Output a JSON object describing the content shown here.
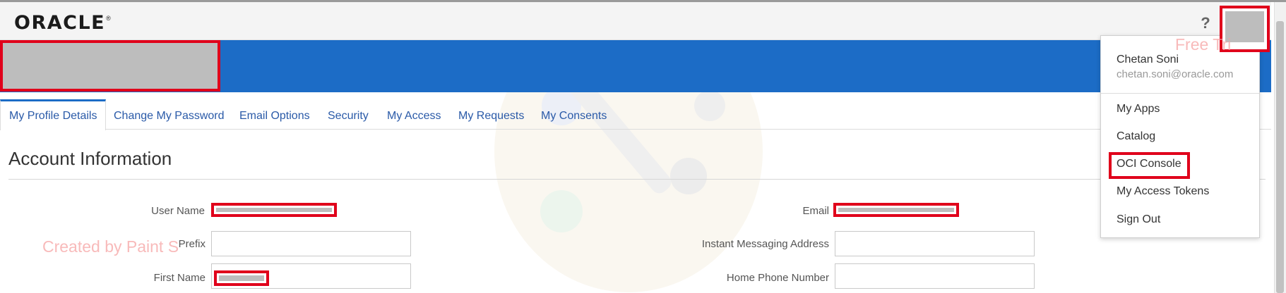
{
  "header": {
    "logo_text": "ORACLE",
    "logo_mark": "®",
    "help_label": "?",
    "help_icon": "question-icon",
    "avatar_icon": "user-avatar-icon"
  },
  "tabs": [
    {
      "label": "My Profile Details",
      "active": true
    },
    {
      "label": "Change My Password",
      "active": false
    },
    {
      "label": "Email Options",
      "active": false
    },
    {
      "label": "Security",
      "active": false
    },
    {
      "label": "My Access",
      "active": false
    },
    {
      "label": "My Requests",
      "active": false
    },
    {
      "label": "My Consents",
      "active": false
    }
  ],
  "section": {
    "title": "Account Information"
  },
  "form": {
    "user_name_label": "User Name",
    "email_label": "Email",
    "prefix_label": "Prefix",
    "prefix_value": "",
    "im_label": "Instant Messaging Address",
    "im_value": "",
    "first_name_label": "First Name",
    "home_phone_label": "Home Phone Number",
    "home_phone_value": ""
  },
  "dropdown": {
    "user_name": "Chetan Soni",
    "user_email": "chetan.soni@oracle.com",
    "items": [
      "My Apps",
      "Catalog",
      "OCI Console",
      "My Access Tokens",
      "Sign Out"
    ],
    "highlighted": "OCI Console"
  },
  "watermarks": {
    "left": "Created by Paint S",
    "right": "Free Tri"
  },
  "colors": {
    "brand_blue": "#1c6cc6",
    "annotation_red": "#e0001b",
    "redaction_gray": "#bdbdbd",
    "link_blue": "#2a5aa8"
  }
}
